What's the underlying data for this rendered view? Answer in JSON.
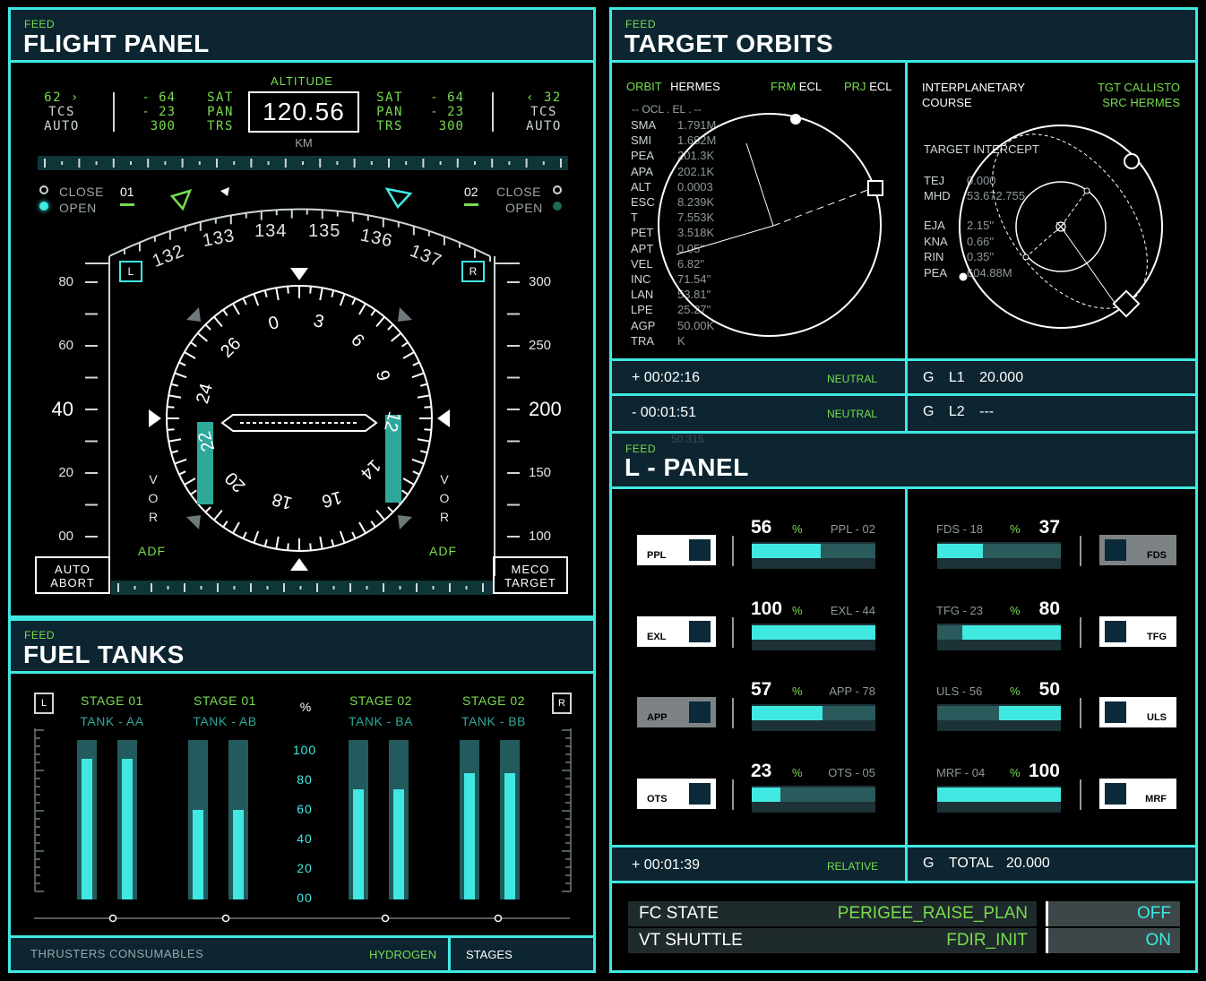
{
  "flight_panel": {
    "feed": "FEED",
    "title": "FLIGHT PANEL",
    "left_col1": [
      "62 ›",
      "TCS",
      "AUTO"
    ],
    "left_col2": [
      "- 64",
      "- 23",
      "300"
    ],
    "left_col3": [
      "SAT",
      "PAN",
      "TRS"
    ],
    "right_col3": [
      "SAT",
      "PAN",
      "TRS"
    ],
    "right_col2": [
      "- 64",
      "- 23",
      "300"
    ],
    "right_col1": [
      "‹ 32",
      "TCS",
      "AUTO"
    ],
    "altitude_label": "ALTITUDE",
    "altitude_value": "120.56",
    "altitude_unit": "KM",
    "close_left": "CLOSE",
    "open_left": "OPEN",
    "close_right": "CLOSE",
    "open_right": "OPEN",
    "ch_left": "01",
    "ch_right": "02",
    "heading_ticks": [
      "132",
      "133",
      "134",
      "135",
      "136",
      "137"
    ],
    "L": "L",
    "R": "R",
    "left_scale": [
      "80",
      "60",
      "40",
      "20",
      "00"
    ],
    "right_scale": [
      "300",
      "250",
      "200",
      "150",
      "100"
    ],
    "compass": [
      "0",
      "3",
      "6",
      "9",
      "12",
      "14",
      "16",
      "18",
      "20",
      "22",
      "24",
      "26"
    ],
    "vor": [
      "V",
      "O",
      "R"
    ],
    "adf_left": "ADF",
    "adf_right": "ADF",
    "auto_abort": [
      "AUTO",
      "ABORT"
    ],
    "meco_target": [
      "MECO",
      "TARGET"
    ]
  },
  "fuel_tanks": {
    "feed": "FEED",
    "title": "FUEL TANKS",
    "L": "L",
    "R": "R",
    "pct": "%",
    "stages": [
      {
        "stage": "STAGE 01",
        "tank": "TANK - AA",
        "levels": [
          0.88,
          0.88
        ]
      },
      {
        "stage": "STAGE 01",
        "tank": "TANK - AB",
        "levels": [
          0.56,
          0.56
        ]
      },
      {
        "stage": "STAGE 02",
        "tank": "TANK - BA",
        "levels": [
          0.69,
          0.69
        ]
      },
      {
        "stage": "STAGE 02",
        "tank": "TANK - BB",
        "levels": [
          0.79,
          0.79
        ]
      }
    ],
    "scale": [
      "100",
      "80",
      "60",
      "40",
      "20",
      "00"
    ],
    "footer_label": "THRUSTERS CONSUMABLES",
    "footer_value": "HYDROGEN",
    "footer_tab": "STAGES"
  },
  "target_orbits": {
    "feed": "FEED",
    "title": "TARGET ORBITS",
    "orbit_label": "ORBIT",
    "orbit_value": "HERMES",
    "frm_label": "FRM",
    "frm_value": "ECL",
    "prj_label": "PRJ",
    "prj_value": "ECL",
    "ocl_header": "-- OCL . EL . --",
    "rows": [
      {
        "k": "SMA",
        "v": "1.791M"
      },
      {
        "k": "SMI",
        "v": "1.682M"
      },
      {
        "k": "PEA",
        "v": "201.3K"
      },
      {
        "k": "APA",
        "v": "202.1K"
      },
      {
        "k": "ALT",
        "v": "0.0003"
      },
      {
        "k": "ESC",
        "v": "8.239K"
      },
      {
        "k": "T",
        "v": "7.553K"
      },
      {
        "k": "PET",
        "v": "3.518K"
      },
      {
        "k": "APT",
        "v": "0.05''"
      },
      {
        "k": "VEL",
        "v": "6.82''"
      },
      {
        "k": "INC",
        "v": "71.54''"
      },
      {
        "k": "LAN",
        "v": "53.81''"
      },
      {
        "k": "LPE",
        "v": "25.27''"
      },
      {
        "k": "AGP",
        "v": "50.00K"
      },
      {
        "k": "TRA",
        "v": "K"
      }
    ],
    "course": [
      "INTERPLANETARY",
      "COURSE"
    ],
    "tgt_label": "TGT",
    "tgt_value": "CALLISTO",
    "src_label": "SRC",
    "src_value": "HERMES",
    "intercept": "TARGET INTERCEPT",
    "rows2a": [
      {
        "k": "TEJ",
        "v": "0.000"
      },
      {
        "k": "MHD",
        "v": "53.672.755"
      }
    ],
    "rows2b": [
      {
        "k": "EJA",
        "v": "2.15''"
      },
      {
        "k": "KNA",
        "v": "0.66''"
      },
      {
        "k": "RIN",
        "v": "0.35''"
      },
      {
        "k": "PEA",
        "v": "604.88M"
      }
    ],
    "timer1": "+ 00:02:16",
    "timer1_mode": "NEUTRAL",
    "timer2": "- 00:01:51",
    "timer2_mode": "NEUTRAL",
    "g1": "G",
    "l1": "L1",
    "l1v": "20.000",
    "g2": "G",
    "l2": "L2",
    "l2v": "---"
  },
  "l_panel": {
    "feed": "FEED",
    "title": "L - PANEL",
    "ghost": "50.315",
    "left": [
      {
        "btn": "PPL",
        "val": "56",
        "pct": "%",
        "code": "PPL - 02",
        "fill": 0.56,
        "gray": false
      },
      {
        "btn": "EXL",
        "val": "100",
        "pct": "%",
        "code": "EXL - 44",
        "fill": 1.0,
        "gray": false
      },
      {
        "btn": "APP",
        "val": "57",
        "pct": "%",
        "code": "APP - 78",
        "fill": 0.57,
        "gray": true
      },
      {
        "btn": "OTS",
        "val": "23",
        "pct": "%",
        "code": "OTS - 05",
        "fill": 0.23,
        "gray": false
      }
    ],
    "right": [
      {
        "btn": "FDS",
        "val": "37",
        "pct": "%",
        "code": "FDS - 18",
        "fill": 0.37,
        "gray": true,
        "from": 0
      },
      {
        "btn": "TFG",
        "val": "80",
        "pct": "%",
        "code": "TFG - 23",
        "fill": 0.8,
        "gray": false,
        "from": 0.2
      },
      {
        "btn": "ULS",
        "val": "50",
        "pct": "%",
        "code": "ULS - 56",
        "fill": 0.5,
        "gray": false,
        "from": 0.5
      },
      {
        "btn": "MRF",
        "val": "100",
        "pct": "%",
        "code": "MRF - 04",
        "fill": 1.0,
        "gray": false,
        "from": 0
      }
    ],
    "timer": "+ 00:01:39",
    "timer_mode": "RELATIVE",
    "g": "G",
    "total": "TOTAL",
    "total_v": "20.000"
  },
  "status": {
    "rows": [
      {
        "k": "FC STATE",
        "v": "PERIGEE_RAISE_PLAN",
        "t": "OFF"
      },
      {
        "k": "VT SHUTTLE",
        "v": "FDIR_INIT",
        "t": "ON"
      }
    ]
  }
}
